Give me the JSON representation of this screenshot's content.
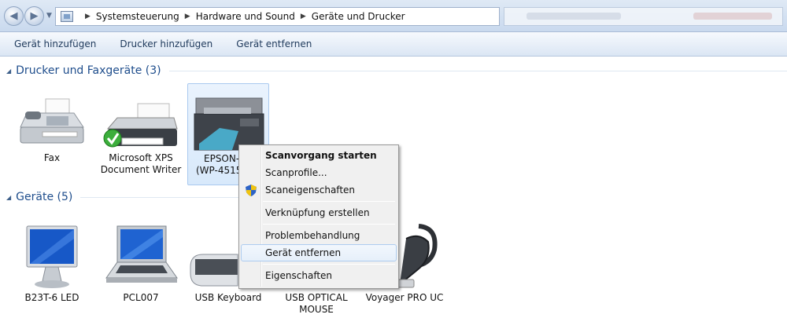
{
  "address": {
    "crumbs": [
      "Systemsteuerung",
      "Hardware und Sound",
      "Geräte und Drucker"
    ]
  },
  "commands": [
    "Gerät hinzufügen",
    "Drucker hinzufügen",
    "Gerät entfernen"
  ],
  "groups": {
    "printers": {
      "title": "Drucker und Faxgeräte (3)",
      "items": [
        {
          "line1": "Fax",
          "line2": ""
        },
        {
          "line1": "Microsoft XPS",
          "line2": "Document Writer"
        },
        {
          "line1": "EPSON-4",
          "line2": "(WP-4515"
        }
      ]
    },
    "devices": {
      "title": "Geräte (5)",
      "items": [
        {
          "line1": "B23T-6 LED",
          "line2": ""
        },
        {
          "line1": "PCL007",
          "line2": ""
        },
        {
          "line1": "USB Keyboard",
          "line2": ""
        },
        {
          "line1": "USB OPTICAL",
          "line2": "MOUSE"
        },
        {
          "line1": "Voyager PRO UC",
          "line2": ""
        }
      ]
    }
  },
  "context_menu": {
    "items": [
      "Scanvorgang starten",
      "Scanprofile...",
      "Scaneigenschaften",
      "Verknüpfung erstellen",
      "Problembehandlung",
      "Gerät entfernen",
      "Eigenschaften"
    ]
  },
  "colors": {
    "group_header": "#1e4d8c",
    "selection": "#d8e9fb",
    "menu_highlight": "#e6effa"
  }
}
